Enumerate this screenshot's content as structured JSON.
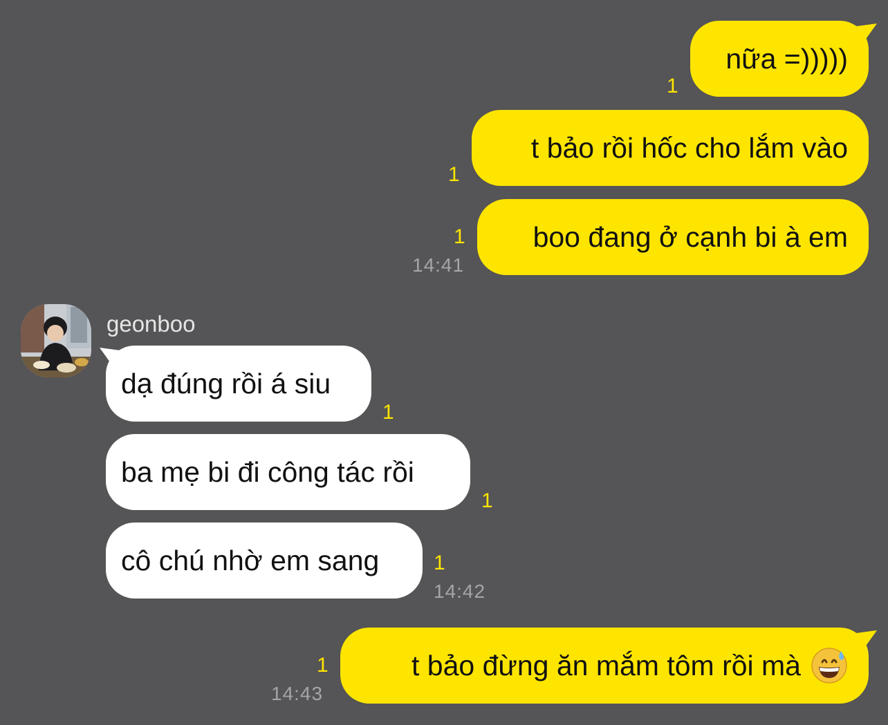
{
  "chat": {
    "colors": {
      "background": "#555456",
      "my_bubble": "#fee500",
      "their_bubble": "#ffffff",
      "unread": "#fee500",
      "timestamp": "#a5a5a7"
    },
    "sender": {
      "name": "geonboo"
    },
    "messages": [
      {
        "from": "me",
        "text": "nữa =)))))",
        "unread": "1"
      },
      {
        "from": "me",
        "text": "t bảo rồi hốc cho lắm vào",
        "unread": "1"
      },
      {
        "from": "me",
        "text": "boo đang ở cạnh bi à em",
        "unread": "1",
        "time": "14:41"
      },
      {
        "from": "them",
        "text": "dạ đúng rồi á siu",
        "unread": "1"
      },
      {
        "from": "them",
        "text": "ba mẹ bi đi công tác rồi",
        "unread": "1"
      },
      {
        "from": "them",
        "text": "cô chú nhờ em sang",
        "unread": "1",
        "time": "14:42"
      },
      {
        "from": "me",
        "text": "t bảo đừng ăn mắm tôm rồi mà",
        "emoji": "grinning-face-with-sweat-emoji",
        "unread": "1",
        "time": "14:43"
      }
    ]
  }
}
